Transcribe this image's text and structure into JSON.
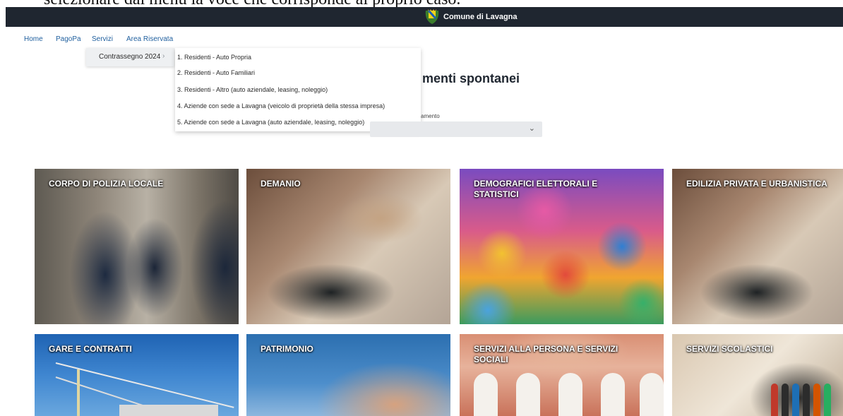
{
  "doc_fragment": "selezionare dal menù la voce che corrisponde al proprio caso.",
  "header": {
    "brand_name": "Comune di Lavagna"
  },
  "nav": {
    "home": "Home",
    "pagopa": "PagoPa",
    "servizi": "Servizi",
    "area_riservata": "Area Riservata"
  },
  "submenu": {
    "label": "Contrassegno 2024",
    "chevron": "›"
  },
  "dropdown": {
    "items": [
      "1. Residenti - Auto Propria",
      "2. Residenti - Auto Familiari",
      "3. Residenti - Altro (auto aziendale, leasing, noleggio)",
      "4. Aziende con sede a Lavagna (veicolo di proprietà della stessa impresa)",
      "5. Aziende con sede a Lavagna (auto aziendale, leasing, noleggio)"
    ]
  },
  "main": {
    "title_fragment": "menti spontanei",
    "field_label_fragment": "amento",
    "select_chevron": "⌄"
  },
  "tiles": [
    "CORPO DI POLIZIA LOCALE",
    "DEMANIO",
    "DEMOGRAFICI ELETTORALI E STATISTICI",
    "EDILIZIA PRIVATA E URBANISTICA",
    "GARE E CONTRATTI",
    "PATRIMONIO",
    "SERVIZI ALLA PERSONA E SERVIZI SOCIALI",
    "SERVIZI SCOLASTICI"
  ],
  "colors": {
    "topbar": "#1f2630",
    "nav_link": "#1f5f9e",
    "crest_yellow": "#f2d31b",
    "crest_blue": "#1d5fb8"
  }
}
